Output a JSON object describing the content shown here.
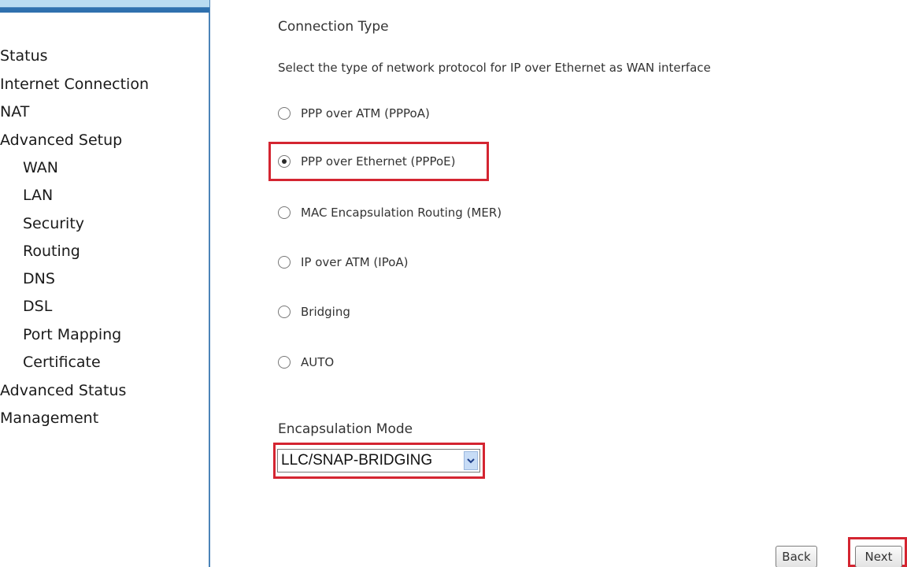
{
  "sidebar": {
    "items": [
      {
        "label": "Status"
      },
      {
        "label": "Internet Connection"
      },
      {
        "label": "NAT"
      },
      {
        "label": "Advanced Setup"
      },
      {
        "label": "WAN"
      },
      {
        "label": "LAN"
      },
      {
        "label": "Security"
      },
      {
        "label": "Routing"
      },
      {
        "label": "DNS"
      },
      {
        "label": "DSL"
      },
      {
        "label": "Port Mapping"
      },
      {
        "label": "Certificate"
      },
      {
        "label": "Advanced Status"
      },
      {
        "label": "Management"
      }
    ]
  },
  "main": {
    "heading": "Connection Type",
    "description": "Select the type of network protocol for IP over Ethernet as WAN interface",
    "options": [
      {
        "label": "PPP over ATM (PPPoA)",
        "checked": false
      },
      {
        "label": "PPP over Ethernet (PPPoE)",
        "checked": true
      },
      {
        "label": "MAC Encapsulation Routing (MER)",
        "checked": false
      },
      {
        "label": "IP over ATM (IPoA)",
        "checked": false
      },
      {
        "label": "Bridging",
        "checked": false
      },
      {
        "label": "AUTO",
        "checked": false
      }
    ],
    "encapsulation": {
      "label": "Encapsulation Mode",
      "selected": "LLC/SNAP-BRIDGING"
    },
    "buttons": {
      "back": "Back",
      "next": "Next"
    }
  },
  "colors": {
    "highlight": "#d42531",
    "sidebar_bar": "#2f70ae",
    "sidebar_bar_light": "#b9dbf1"
  },
  "icons": {
    "select_arrow": "chevron-down-icon",
    "radio": "radio-icon"
  }
}
